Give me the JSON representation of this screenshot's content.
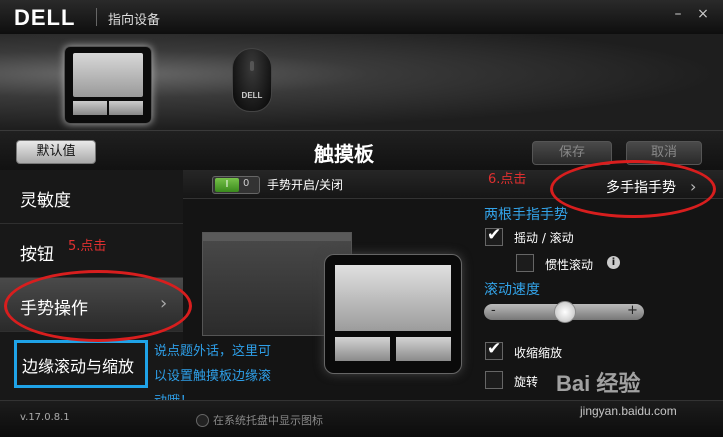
{
  "titlebar": {
    "brand": "DELL",
    "title": "指向设备",
    "minimize": "–",
    "close": "×"
  },
  "devices": {
    "mouse_brand": "DELL"
  },
  "toolbar": {
    "default_label": "默认值",
    "page_title": "触摸板",
    "save_label": "保存",
    "cancel_label": "取消"
  },
  "sidebar": {
    "items": [
      {
        "label": "灵敏度"
      },
      {
        "label": "按钮"
      },
      {
        "label": "手势操作"
      }
    ],
    "edge_item": "边缘滚动与缩放"
  },
  "main": {
    "toggle_on": "I",
    "toggle_off": "0",
    "gesture_toggle_label": "手势开启/关闭",
    "multi_finger_label": "多手指手势",
    "two_finger_heading": "两根手指手势",
    "options": {
      "pan_scroll": "摇动 / 滚动",
      "inertial_scroll": "惯性滚动",
      "pinch_zoom": "收缩缩放",
      "rotate": "旋转"
    },
    "scroll_speed_heading": "滚动速度",
    "slider": {
      "minus": "-",
      "plus": "+",
      "value": 0.5
    }
  },
  "annotations": {
    "step5": "5.点击",
    "step6": "6.点击",
    "note_line1": "说点题外话，这里可",
    "note_line2": "以设置触摸板边缘滚",
    "note_line3": "动哦！"
  },
  "status": {
    "version": "v.17.0.8.1",
    "tray_label": "在系统托盘中显示图标"
  },
  "watermark": {
    "logo": "Bai 经验",
    "url": "jingyan.baidu.com"
  },
  "colors": {
    "accent_blue": "#33a3e8",
    "annotation_red": "#d81e1e",
    "toggle_green": "#3a8a1c"
  }
}
